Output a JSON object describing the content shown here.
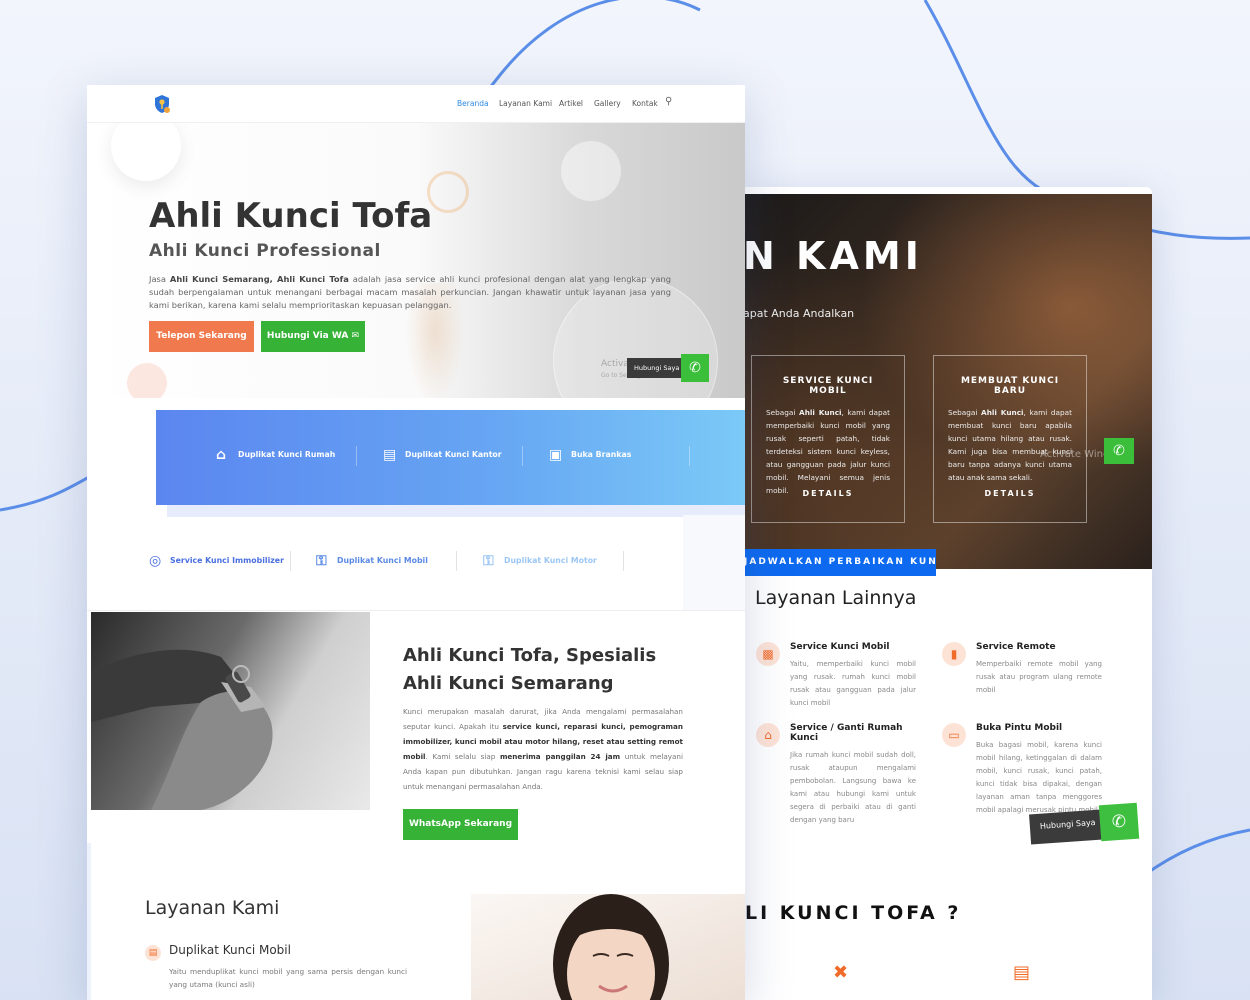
{
  "colors": {
    "accent_blue": "#2e8ae6",
    "orange": "#f07a4e",
    "green": "#36b336",
    "band_start": "#5b86f0",
    "band_end": "#7ccbf7",
    "icon_orange": "#f06b2a"
  },
  "front": {
    "nav": {
      "logo_icon": "shield-key-icon",
      "items": [
        "Beranda",
        "Layanan Kami",
        "Artikel",
        "Gallery",
        "Kontak"
      ],
      "active": "Beranda",
      "search_icon": "search-icon"
    },
    "hero": {
      "title": "Ahli Kunci Tofa",
      "subtitle": "Ahli Kunci Professional",
      "desc_prefix": "Jasa ",
      "desc_bold1": "Ahli Kunci Semarang, Ahli Kunci Tofa",
      "desc_rest": " adalah jasa service ahli kunci profesional dengan alat yang lengkap yang sudah berpengalaman untuk menangani berbagai macam masalah perkuncian. Jangan khawatir untuk layanan jasa yang kami berikan, karena kami selalu memprioritaskan kepuasan pelanggan.",
      "btn_phone": "Telepon Sekarang",
      "btn_wa": "Hubungi Via WA",
      "float_label": "Hubungi Saya",
      "watermark1": "Activate Windows",
      "watermark2": "Go to Settings to activate Windows."
    },
    "band_items": [
      {
        "label": "Duplikat Kunci Rumah",
        "icon": "home-icon"
      },
      {
        "label": "Duplikat Kunci Kantor",
        "icon": "building-icon"
      },
      {
        "label": "Buka Brankas",
        "icon": "lock-icon"
      }
    ],
    "row2_items": [
      {
        "label": "Service Kunci Immobilizer",
        "icon": "target-icon",
        "color": "#4a6fe0"
      },
      {
        "label": "Duplikat Kunci Mobil",
        "icon": "key-icon",
        "color": "#5b8ae6"
      },
      {
        "label": "Duplikat Kunci Motor",
        "icon": "key-icon",
        "color": "#9cc6f5"
      }
    ],
    "about": {
      "title_line1": "Ahli Kunci Tofa, Spesialis",
      "title_line2": "Ahli Kunci Semarang",
      "desc_a": "Kunci merupakan masalah darurat, jika Anda mengalami permasalahan seputar kunci. Apakah itu ",
      "desc_b": "service kunci, reparasi kunci, pemograman immobilizer, kunci mobil atau motor hilang, reset atau setting remot mobil",
      "desc_c": ". Kami selalu siap ",
      "desc_d": "menerima panggilan 24 jam",
      "desc_e": " untuk melayani Anda kapan pun dibutuhkan. Jangan ragu karena teknisi kami selau siap untuk menangani permasalahan Anda.",
      "btn": "WhatsApp Sekarang"
    },
    "layanan": {
      "title": "Layanan Kami",
      "item_title": "Duplikat Kunci Mobil",
      "item_desc": "Yaitu menduplikat kunci mobil yang sama persis dengan kunci yang utama (kunci asli)"
    }
  },
  "back": {
    "hero_title": "N KAMI",
    "hero_sub": "apat Anda Andalkan",
    "boxes": [
      {
        "title": "SERVICE KUNCI MOBIL",
        "desc_a": "Sebagai ",
        "desc_b": "Ahli Kunci",
        "desc_c": ", kami dapat memperbaiki kunci mobil yang rusak seperti patah, tidak terdeteksi sistem kunci keyless, atau gangguan pada jalur kunci mobil. Melayani semua jenis mobil.",
        "details": "DETAILS"
      },
      {
        "title": "MEMBUAT KUNCI BARU",
        "desc_a": "Sebagai ",
        "desc_b": "Ahli Kunci",
        "desc_c": ", kami dapat membuat kunci baru apabila kunci utama hilang atau rusak. Kami juga bisa membuat kunci baru tanpa adanya kunci utama atau anak sama sekali.",
        "details": "DETAILS"
      }
    ],
    "blue_btn": "JADWALKAN PERBAIKAN KUNCI",
    "watermark": "Activate Windows",
    "lainnya_title": "Layanan Lainnya",
    "features": [
      {
        "title": "Service Kunci Mobil",
        "desc": "Yaitu, memperbaiki kunci mobil yang rusak. rumah kunci mobil rusak atau gangguan pada jalur kunci mobil",
        "icon": "car-icon"
      },
      {
        "title": "Service Remote",
        "desc": "Memperbaiki remote mobil yang rusak atau program ulang remote mobil",
        "icon": "remote-icon"
      },
      {
        "title": "Service / Ganti Rumah Kunci",
        "desc": "Jika rumah kunci mobil sudah doll, rusak ataupun mengalami pembobolan. Langsung bawa ke kami atau hubungi kami untuk segera di perbaiki atau di ganti dengan yang baru",
        "icon": "house-icon"
      },
      {
        "title": "Buka Pintu Mobil",
        "desc": "Buka bagasi mobil, karena kunci mobil hilang, ketinggalan di dalam mobil, kunci rusak, kunci patah, kunci tidak bisa dipakai, dengan layanan aman tanpa menggores mobil apalagi merusak pintu mobil",
        "icon": "car-door-icon"
      }
    ],
    "cta_label": "Hubungi Saya",
    "bottom_title": "LI KUNCI TOFA ?",
    "bottom_icons": [
      "tools-icon",
      "document-icon"
    ]
  }
}
